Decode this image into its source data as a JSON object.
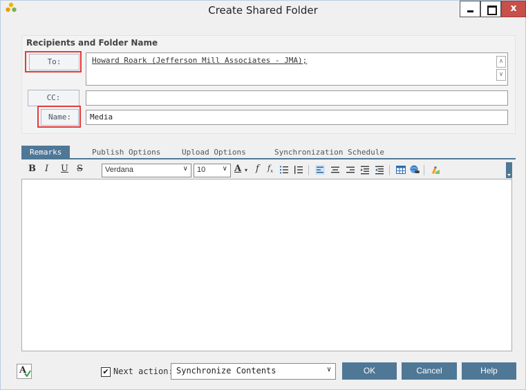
{
  "window": {
    "title": "Create Shared Folder",
    "close_glyph": "x"
  },
  "recipients": {
    "heading": "Recipients and Folder Name",
    "to_label": "To:",
    "to_value": "Howard Roark (Jefferson Mill Associates - JMA)",
    "to_value_suffix": ";",
    "cc_label": "CC:",
    "cc_value": "",
    "name_label": "Name:",
    "name_value": "Media"
  },
  "tabs": [
    {
      "label": "Remarks",
      "active": true
    },
    {
      "label": "Publish Options",
      "active": false
    },
    {
      "label": "Upload Options",
      "active": false
    },
    {
      "label": "Synchronization Schedule",
      "active": false
    }
  ],
  "toolbar": {
    "bold": "B",
    "italic": "I",
    "underline": "U",
    "strike": "S",
    "font_family": "Verdana",
    "font_size": "10",
    "font_color_glyph": "A",
    "icons": [
      "bold-icon",
      "italic-icon",
      "underline-icon",
      "strikethrough-icon",
      "font-color-icon",
      "function-icon",
      "formula-icon",
      "numbered-list-icon",
      "bullet-list-icon",
      "align-left-icon",
      "align-center-icon",
      "align-right-icon",
      "indent-icon",
      "outdent-icon",
      "table-icon",
      "hyperlink-icon",
      "highlight-icon"
    ]
  },
  "footer": {
    "spell_glyph": "A",
    "next_action_checked": true,
    "next_action_label": "Next action:",
    "next_action_value": "Synchronize Contents",
    "ok_label": "OK",
    "cancel_label": "Cancel",
    "help_label": "Help"
  },
  "colors": {
    "accent": "#4f7796",
    "highlight_box": "#e23b3b",
    "close_button": "#c7504a"
  }
}
